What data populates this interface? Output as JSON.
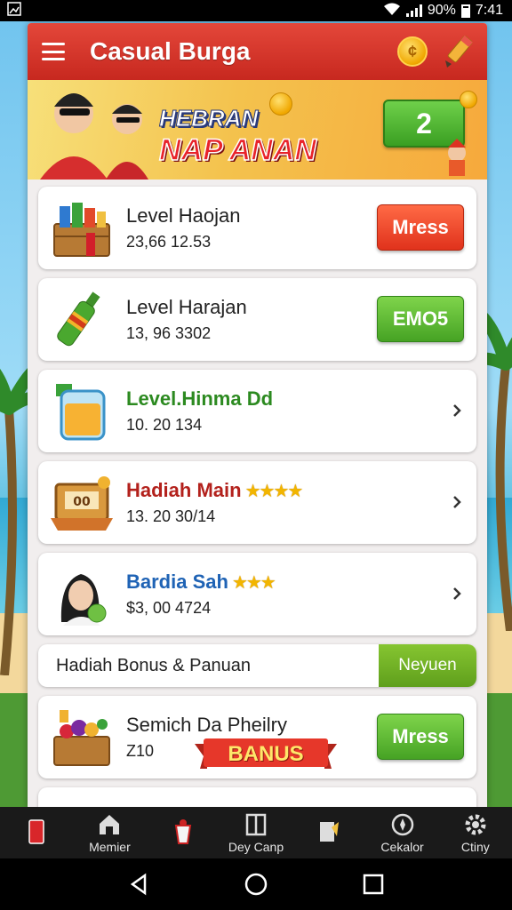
{
  "status_bar": {
    "battery": "90%",
    "time": "7:41"
  },
  "app": {
    "title": "Casual Burga"
  },
  "banner": {
    "line1": "HEBRAN",
    "line2": "NAP ANAN",
    "count": "2"
  },
  "list": [
    {
      "title": "Level Haojan",
      "subtitle": "23,66 12.53",
      "action": "Mress",
      "style": "red"
    },
    {
      "title": "Level Harajan",
      "subtitle": "13, 96 3302",
      "action": "EMO5",
      "style": "green"
    },
    {
      "title": "Level.Hinma Dd",
      "subtitle": "10. 20 134",
      "action": "",
      "style": "chevron"
    },
    {
      "title": "Hadiah Main",
      "subtitle": "13. 20 30/14",
      "action": "",
      "style": "chevron",
      "stars": "★★★★"
    },
    {
      "title": "Bardia Sah",
      "subtitle": "$3, 00 4724",
      "action": "",
      "style": "chevron",
      "stars": "★★★"
    }
  ],
  "bonus_row": {
    "label": "Hadiah Bonus & Panuan",
    "action": "Neyuen"
  },
  "bonus_card": {
    "title": "Semich Da Pheilry",
    "subtitle": "Z10",
    "action": "Mress",
    "ribbon": "BANUS"
  },
  "bottom_nav": [
    {
      "label": "",
      "icon": "phone-icon"
    },
    {
      "label": "Memier",
      "icon": "home-icon"
    },
    {
      "label": "",
      "icon": "cup-icon"
    },
    {
      "label": "Dey Canp",
      "icon": "columns-icon"
    },
    {
      "label": "",
      "icon": "note-icon"
    },
    {
      "label": "Cekalor",
      "icon": "compass-icon"
    },
    {
      "label": "Ctiny",
      "icon": "gear-icon"
    }
  ],
  "colors": {
    "appbar": "#d2322a",
    "accent_red": "#e0321c",
    "accent_green": "#46a324"
  }
}
